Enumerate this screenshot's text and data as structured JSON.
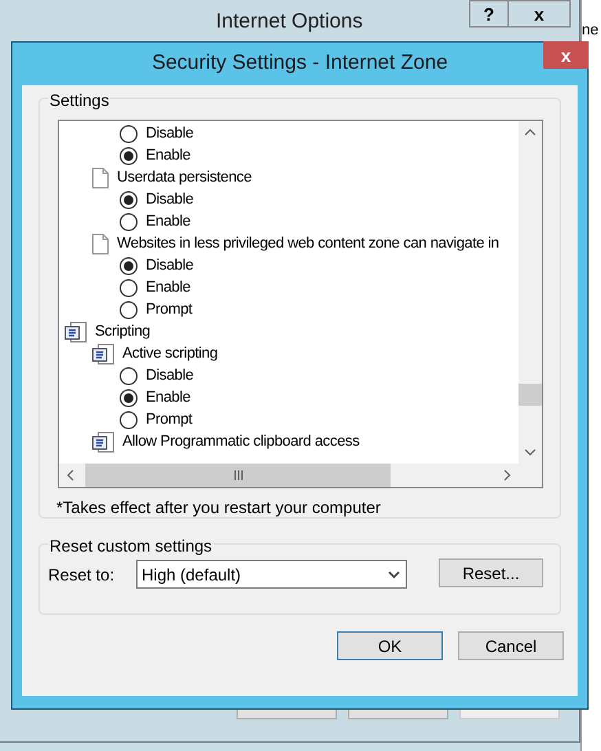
{
  "back_window": {
    "title": "Internet Options",
    "help_button": "?",
    "close_button": "x",
    "edge_text": "ne"
  },
  "dialog": {
    "title": "Security Settings - Internet Zone",
    "close_button": "x"
  },
  "settings": {
    "label": "Settings",
    "tree": [
      {
        "kind": "continued",
        "children": [
          {
            "kind": "continued",
            "children": [
              {
                "kind": "radio",
                "label": "Disable",
                "selected": false
              },
              {
                "kind": "radio",
                "label": "Enable",
                "selected": true
              }
            ]
          },
          {
            "kind": "page",
            "label": "Userdata persistence",
            "children": [
              {
                "kind": "radio",
                "label": "Disable",
                "selected": true
              },
              {
                "kind": "radio",
                "label": "Enable",
                "selected": false
              }
            ]
          },
          {
            "kind": "page",
            "label": "Websites in less privileged web content zone can navigate in",
            "children": [
              {
                "kind": "radio",
                "label": "Disable",
                "selected": true
              },
              {
                "kind": "radio",
                "label": "Enable",
                "selected": false
              },
              {
                "kind": "radio",
                "label": "Prompt",
                "selected": false
              }
            ]
          }
        ]
      },
      {
        "kind": "script",
        "label": "Scripting",
        "children": [
          {
            "kind": "script",
            "label": "Active scripting",
            "children": [
              {
                "kind": "radio",
                "label": "Disable",
                "selected": false
              },
              {
                "kind": "radio",
                "label": "Enable",
                "selected": true
              },
              {
                "kind": "radio",
                "label": "Prompt",
                "selected": false
              }
            ]
          },
          {
            "kind": "script",
            "label": "Allow Programmatic clipboard access"
          }
        ]
      }
    ],
    "note": "*Takes effect after you restart your computer"
  },
  "reset": {
    "label": "Reset custom settings",
    "reset_to_label": "Reset to:",
    "value": "High (default)",
    "button": "Reset..."
  },
  "buttons": [
    "OK",
    "Cancel"
  ]
}
